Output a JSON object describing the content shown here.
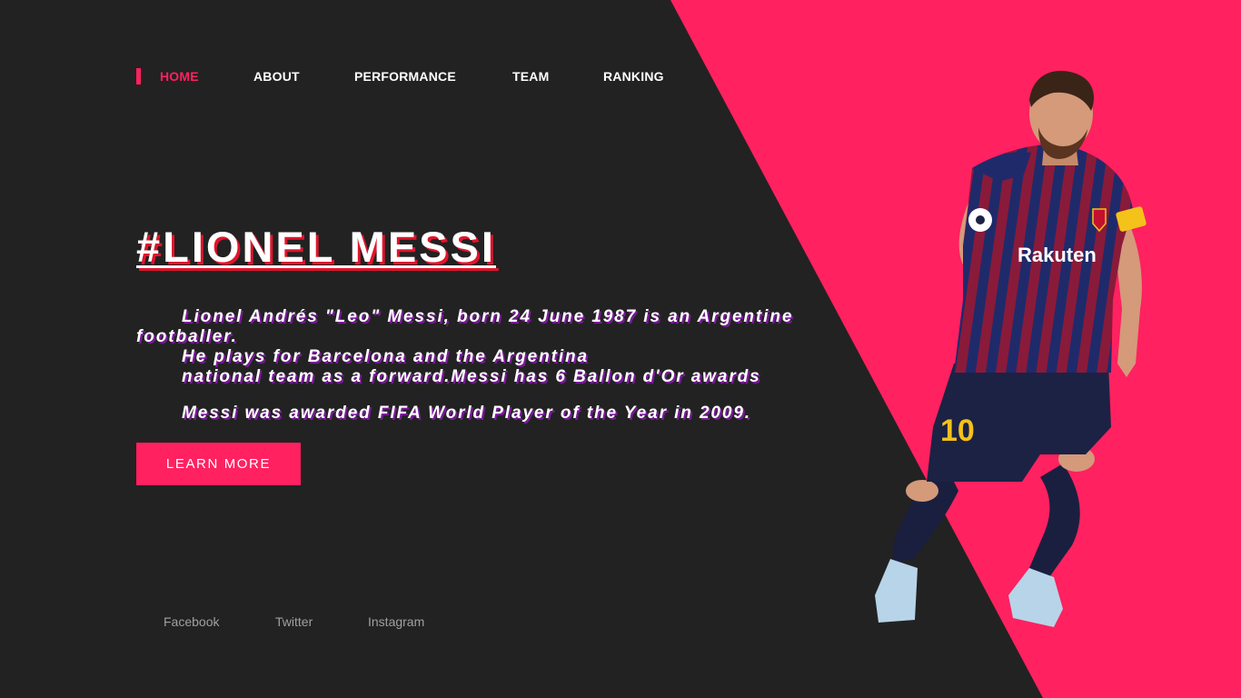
{
  "colors": {
    "background": "#222222",
    "accent": "#ff2160",
    "text": "#ffffff",
    "muted": "#a0a0a0"
  },
  "nav": {
    "items": [
      {
        "label": "HOME",
        "active": true
      },
      {
        "label": "ABOUT",
        "active": false
      },
      {
        "label": "PERFORMANCE",
        "active": false
      },
      {
        "label": "TEAM",
        "active": false
      },
      {
        "label": "RANKING",
        "active": false
      }
    ]
  },
  "hero": {
    "title": "#LIONEL MESSI",
    "bio_lines": [
      "Lionel Andrés \"Leo\" Messi, born 24 June 1987 is an Argentine",
      "footballer.",
      "He plays for Barcelona and the Argentina",
      "national team as a forward.Messi has 6 Ballon d'Or awards",
      "Messi was awarded FIFA World Player of the Year in 2009."
    ],
    "cta_label": "LEARN MORE"
  },
  "social": {
    "links": [
      "Facebook",
      "Twitter",
      "Instagram"
    ]
  },
  "player": {
    "shirt_sponsor": "Rakuten",
    "shirt_number": "10"
  }
}
